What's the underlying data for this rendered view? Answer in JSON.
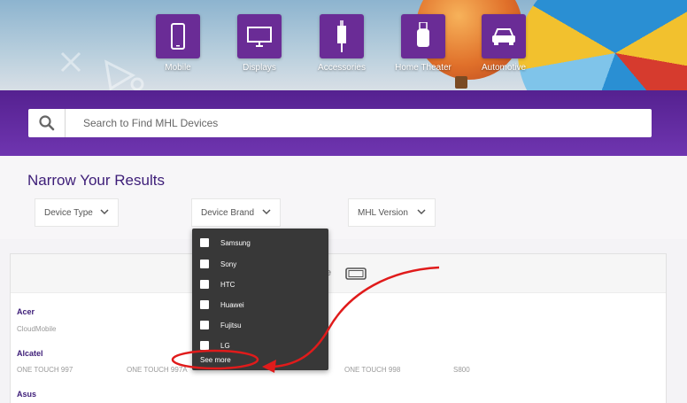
{
  "categories": [
    {
      "label": "Mobile",
      "icon": "mobile-phone-icon"
    },
    {
      "label": "Displays",
      "icon": "display-monitor-icon"
    },
    {
      "label": "Accessories",
      "icon": "accessories-icon"
    },
    {
      "label": "Home Theater",
      "icon": "home-theater-icon"
    },
    {
      "label": "Automotive",
      "icon": "car-icon"
    }
  ],
  "search": {
    "placeholder": "Search to Find MHL Devices",
    "icon": "search-icon"
  },
  "filters": {
    "title": "Narrow Your Results",
    "device_type": "Device Type",
    "device_brand": "Device Brand",
    "mhl_version": "MHL Version"
  },
  "brand_menu": {
    "items": [
      "Samsung",
      "Sony",
      "HTC",
      "Huawei",
      "Fujitsu",
      "LG"
    ],
    "see_more": "See more"
  },
  "results": {
    "header_text": "e",
    "brands": [
      {
        "name": "Acer",
        "models": [
          "CloudMobile"
        ]
      },
      {
        "name": "Alcatel",
        "models": [
          "ONE TOUCH 997",
          "ONE TOUCH 997A",
          "ONE TOUCH 998",
          "S800"
        ]
      },
      {
        "name": "Asus",
        "models": []
      }
    ]
  },
  "colors": {
    "brand_purple": "#552190",
    "accent_red": "#e01b1b",
    "menu_bg": "#383838",
    "title_purple": "#3d1d78"
  }
}
